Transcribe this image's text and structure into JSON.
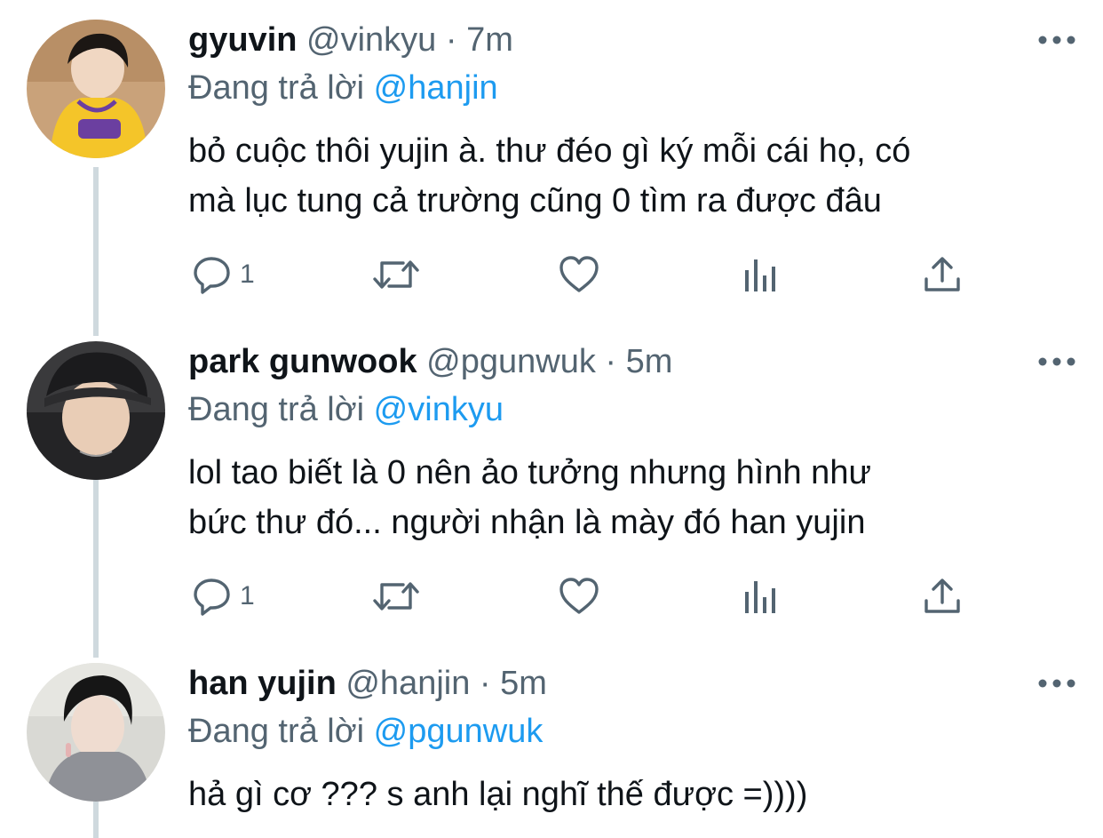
{
  "tweets": [
    {
      "display_name": "gyuvin",
      "handle": "@vinkyu",
      "dot": "·",
      "time": "7m",
      "reply_prefix": "Đang trả lời",
      "reply_mention": "@hanjin",
      "lines": [
        "bỏ cuộc thôi yujin à. thư đéo gì ký mỗi cái họ, có",
        "mà lục tung cả trường cũng 0 tìm ra được đâu"
      ],
      "reply_count": "1",
      "avatar_icon": "avatar-photo"
    },
    {
      "display_name": "park gunwook",
      "handle": "@pgunwuk",
      "dot": "·",
      "time": "5m",
      "reply_prefix": "Đang trả lời",
      "reply_mention": "@vinkyu",
      "lines": [
        "lol tao biết là 0 nên ảo tưởng nhưng hình như",
        "bức thư đó... người nhận là mày đó han yujin"
      ],
      "reply_count": "1",
      "avatar_icon": "avatar-photo"
    },
    {
      "display_name": "han yujin",
      "handle": "@hanjin",
      "dot": "·",
      "time": "5m",
      "reply_prefix": "Đang trả lời",
      "reply_mention": "@pgunwuk",
      "lines": [
        "hả gì cơ ??? s anh lại nghĩ thế được =))))"
      ],
      "avatar_icon": "avatar-photo"
    }
  ],
  "colors": {
    "text": "#0f1419",
    "secondary": "#536471",
    "link": "#1d9bf0",
    "thread_line": "#cfd9de"
  }
}
